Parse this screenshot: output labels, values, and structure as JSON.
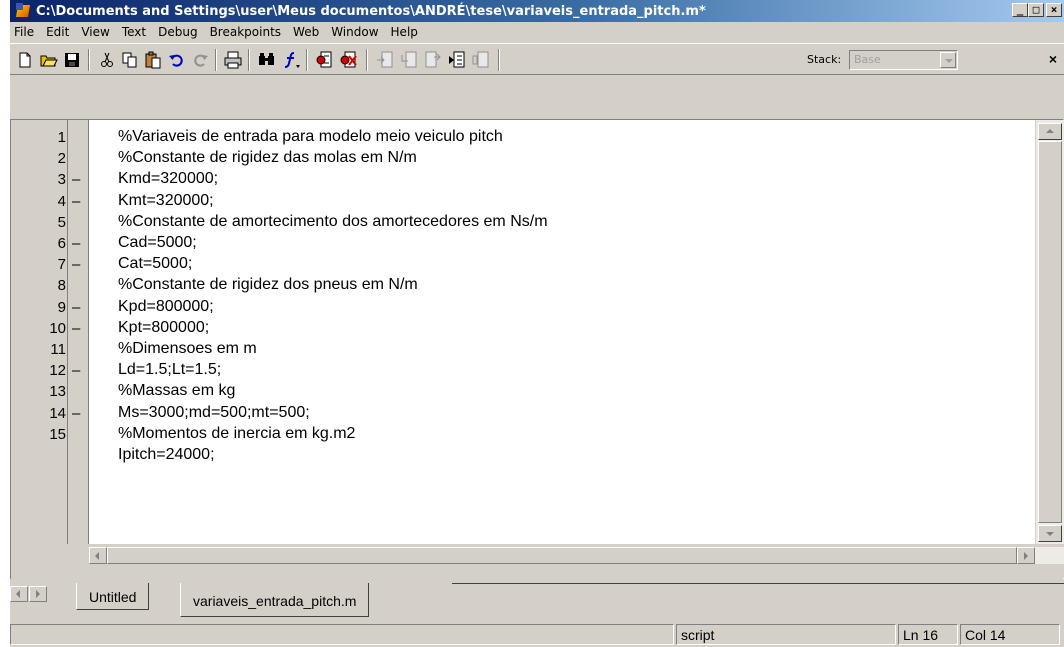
{
  "window": {
    "title": "C:\\Documents and Settings\\user\\Meus documentos\\ANDRÉ\\tese\\variaveis_entrada_pitch.m*",
    "minimize_glyph": "_",
    "maximize_glyph": "□",
    "close_glyph": "×"
  },
  "menu": [
    "File",
    "Edit",
    "View",
    "Text",
    "Debug",
    "Breakpoints",
    "Web",
    "Window",
    "Help"
  ],
  "toolbar": {
    "stack_label": "Stack:",
    "stack_value": "Base",
    "close_glyph": "×",
    "icons": [
      "new-file-icon",
      "open-folder-icon",
      "save-icon",
      "cut-icon",
      "copy-icon",
      "paste-icon",
      "undo-icon",
      "redo-icon",
      "print-icon",
      "find-icon",
      "function-icon",
      "set-breakpoint-icon",
      "clear-breakpoint-icon",
      "step-icon",
      "step-in-icon",
      "step-out-icon",
      "continue-icon",
      "exit-debug-icon"
    ]
  },
  "editor": {
    "lines": [
      {
        "num": "1",
        "dash": "",
        "code": "%Variaveis de entrada para modelo meio veiculo pitch"
      },
      {
        "num": "2",
        "dash": "",
        "code": "%Constante de rigidez das molas em N/m"
      },
      {
        "num": "3",
        "dash": "–",
        "code": "Kmd=320000;"
      },
      {
        "num": "4",
        "dash": "–",
        "code": "Kmt=320000;"
      },
      {
        "num": "5",
        "dash": "",
        "code": "%Constante de amortecimento dos amortecedores em Ns/m"
      },
      {
        "num": "6",
        "dash": "–",
        "code": "Cad=5000;"
      },
      {
        "num": "7",
        "dash": "–",
        "code": "Cat=5000;"
      },
      {
        "num": "8",
        "dash": "",
        "code": "%Constante de rigidez dos pneus em N/m"
      },
      {
        "num": "9",
        "dash": "–",
        "code": "Kpd=800000;"
      },
      {
        "num": "10",
        "dash": "–",
        "code": "Kpt=800000;"
      },
      {
        "num": "11",
        "dash": "",
        "code": "%Dimensoes em m"
      },
      {
        "num": "12",
        "dash": "–",
        "code": "Ld=1.5;Lt=1.5;"
      },
      {
        "num": "13",
        "dash": "",
        "code": "%Massas em kg"
      },
      {
        "num": "14",
        "dash": "–",
        "code": "Ms=3000;md=500;mt=500;"
      },
      {
        "num": "15",
        "dash": "",
        "code": "%Momentos de inercia em kg.m2"
      },
      {
        "num": "",
        "dash": "",
        "code": "Ipitch=24000;"
      }
    ]
  },
  "tabs": [
    {
      "label": "Untitled",
      "active": false
    },
    {
      "label": "variaveis_entrada_pitch.m",
      "active": true
    }
  ],
  "status": {
    "mode": "script",
    "line": "Ln 16",
    "col": "Col 14"
  },
  "colors": {
    "title_start": "#0a246a",
    "title_end": "#a6caf0",
    "chrome": "#d4d0c8",
    "editor_bg": "#ffffff"
  }
}
